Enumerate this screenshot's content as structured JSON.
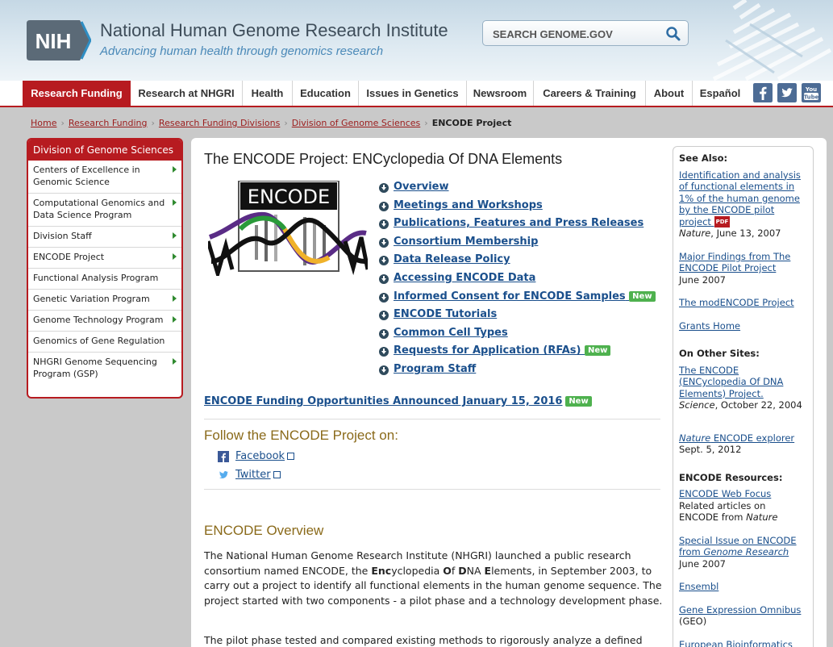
{
  "header": {
    "logo_text": "NIH",
    "institute_name": "National Human Genome Research Institute",
    "tagline": "Advancing human health through genomics research",
    "search_placeholder": "SEARCH GENOME.GOV"
  },
  "nav": {
    "tabs": [
      "Research Funding",
      "Research at NHGRI",
      "Health",
      "Education",
      "Issues in Genetics",
      "Newsroom",
      "Careers & Training",
      "About",
      "Español"
    ],
    "active_tab": "Research Funding",
    "social": [
      "facebook-icon",
      "twitter-icon",
      "youtube-icon"
    ],
    "youtube_text": "You Tube"
  },
  "breadcrumb": {
    "items": [
      "Home",
      "Research Funding",
      "Research Funding Divisions",
      "Division of Genome Sciences"
    ],
    "current": "ENCODE Project"
  },
  "sidebar": {
    "title": "Division of Genome Sciences",
    "items": [
      {
        "label": "Centers of Excellence in Genomic Science",
        "arrow": true
      },
      {
        "label": "Computational Genomics and Data Science Program",
        "arrow": true
      },
      {
        "label": "Division Staff",
        "arrow": true
      },
      {
        "label": "ENCODE Project",
        "arrow": true
      },
      {
        "label": "Functional Analysis Program",
        "arrow": false
      },
      {
        "label": "Genetic Variation Program",
        "arrow": true
      },
      {
        "label": "Genome Technology Program",
        "arrow": true
      },
      {
        "label": "Genomics of Gene Regulation",
        "arrow": false
      },
      {
        "label": "NHGRI Genome Sequencing Program (GSP)",
        "arrow": true
      }
    ]
  },
  "main": {
    "title": "The ENCODE Project: ENCyclopedia Of DNA Elements",
    "logo_text": "ENCODE",
    "links": [
      {
        "label": "Overview",
        "new": false
      },
      {
        "label": "Meetings and Workshops",
        "new": false
      },
      {
        "label": "Publications, Features and Press Releases",
        "new": false
      },
      {
        "label": "Consortium Membership",
        "new": false
      },
      {
        "label": "Data Release Policy",
        "new": false
      },
      {
        "label": "Accessing ENCODE Data",
        "new": false
      },
      {
        "label": "Informed Consent for ENCODE Samples",
        "new": true
      },
      {
        "label": "ENCODE Tutorials",
        "new": false
      },
      {
        "label": "Common Cell Types",
        "new": false
      },
      {
        "label": "Requests for Application (RFAs)",
        "new": true
      },
      {
        "label": "Program Staff",
        "new": false
      }
    ],
    "new_label": "New",
    "funding_link": "ENCODE Funding Opportunities Announced January 15, 2016",
    "follow_heading": "Follow the ENCODE Project on:",
    "follow_links": [
      "Facebook",
      "Twitter"
    ],
    "overview_heading": "ENCODE Overview",
    "overview_p1_a": "The National Human Genome Research Institute (NHGRI) launched a public research consortium named ENCODE, the ",
    "overview_p1_enc": "Enc",
    "overview_p1_b": "yclopedia ",
    "overview_p1_of": "O",
    "overview_p1_c": "f ",
    "overview_p1_d": "D",
    "overview_p1_e": "NA ",
    "overview_p1_el": "E",
    "overview_p1_f": "lements, in September 2003, to carry out a project to identify all functional elements in the human genome sequence. The project started with two components - a pilot phase and a technology development phase.",
    "overview_p2": "The pilot phase tested and compared existing methods to rigorously analyze a defined"
  },
  "see_also": {
    "heading": "See Also:",
    "items": [
      {
        "link": "Identification and analysis of functional elements in 1% of the human genome by the ENCODE pilot project",
        "pdf": "PDF",
        "meta_italic": "Nature",
        "meta": ", June 13, 2007"
      },
      {
        "link": "Major Findings from The ENCODE Pilot Project",
        "meta": "June 2007"
      },
      {
        "link": "The modENCODE Project"
      },
      {
        "link": "Grants Home"
      }
    ],
    "other_heading": "On Other Sites:",
    "other_item1_link": "The ENCODE (ENCyclopedia Of DNA Elements) Project.",
    "other_item1_meta_italic": "Science",
    "other_item1_meta": ", October 22, 2004",
    "other_item2_link_italic": "Nature",
    "other_item2_link": " ENCODE explorer",
    "other_item2_meta": "Sept. 5, 2012",
    "resources_heading": "ENCODE Resources:",
    "res_item1_link": "ENCODE Web Focus",
    "res_item1_meta": "Related articles on ENCODE from ",
    "res_item1_meta_italic": "Nature",
    "res_item2_link": "Special Issue on ENCODE from ",
    "res_item2_link_italic": "Genome Research",
    "res_item2_meta": "June 2007",
    "res_item3_link": "Ensembl",
    "res_item4_link": "Gene Expression Omnibus",
    "res_item4_meta": "(GEO)",
    "res_item5_link": "European Bioinformatics"
  },
  "colors": {
    "brand_red": "#b71b20",
    "link_blue": "#1a4f8c",
    "heading_gold": "#8a6a1a",
    "new_green": "#4eb14e"
  }
}
